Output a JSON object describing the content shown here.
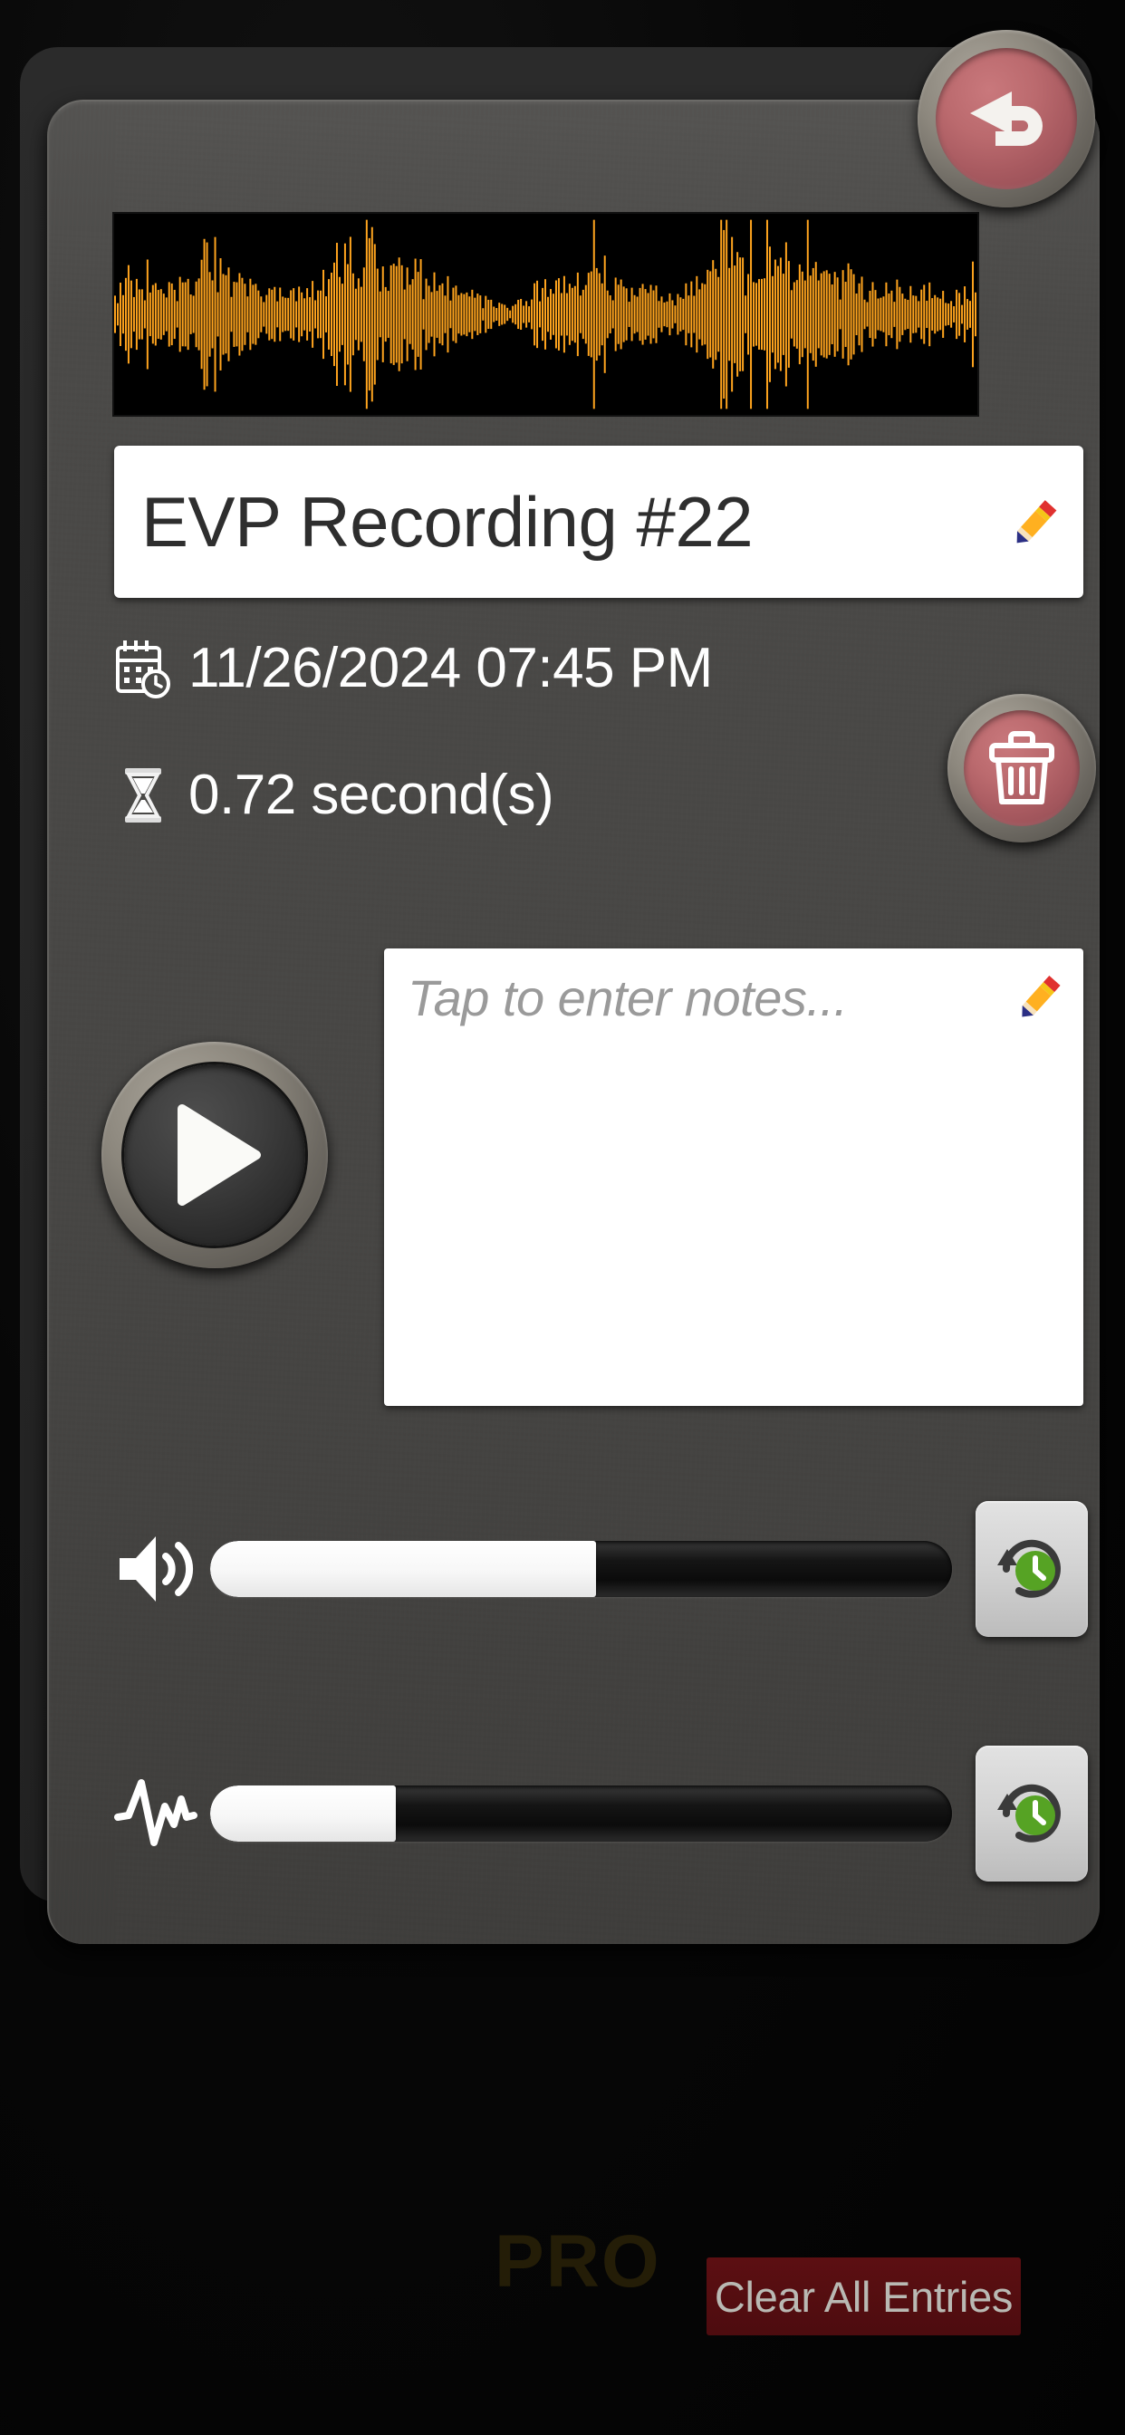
{
  "app": {
    "screen_name": "EVP Recording Detail"
  },
  "header": {
    "back_button": {
      "icon": "undo-arrow-icon",
      "label": "Back"
    }
  },
  "waveform": {
    "icon": "audio-waveform-display",
    "color": "#FFA41E",
    "background": "#000000",
    "label": "Audio waveform"
  },
  "recording": {
    "title": "EVP Recording #22",
    "title_edit_icon": "pencil-icon",
    "date_icon": "calendar-clock-icon",
    "date": "11/26/2024 07:45 PM",
    "duration_icon": "hourglass-icon",
    "duration": "0.72 second(s)"
  },
  "delete_button": {
    "icon": "trash-icon",
    "label": "Delete"
  },
  "play_button": {
    "icon": "play-icon",
    "label": "Play"
  },
  "notes": {
    "placeholder": "Tap to enter notes...",
    "value": "",
    "edit_icon": "pencil-icon"
  },
  "controls": [
    {
      "name": "volume",
      "icon": "speaker-volume-icon",
      "value_percent": 52,
      "reset_icon": "reset-clock-icon"
    },
    {
      "name": "sensitivity",
      "icon": "pulse-waveform-icon",
      "value_percent": 25,
      "reset_icon": "reset-clock-icon"
    }
  ],
  "footer": {
    "pro_watermark": "PRO",
    "clear_all_label": "Clear All Entries",
    "clear_all_color": "#4d0c0f"
  }
}
